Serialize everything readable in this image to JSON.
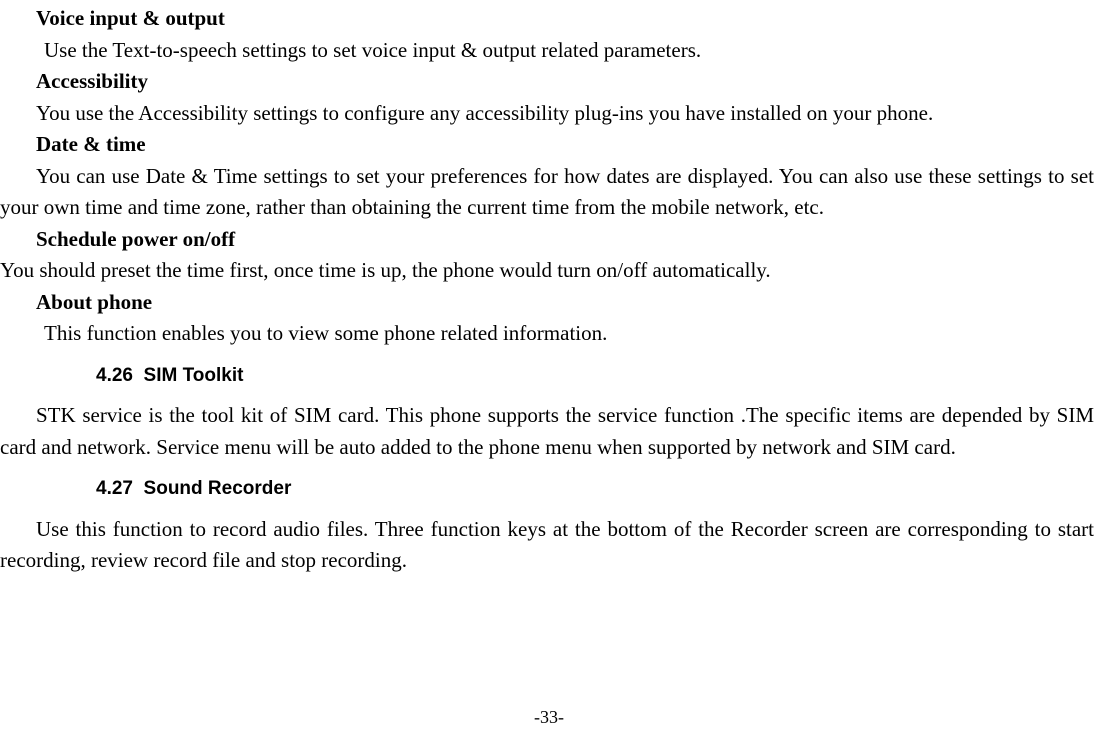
{
  "sections": {
    "voice": {
      "title": "Voice input & output",
      "body": "Use the Text-to-speech settings to set voice input & output related parameters."
    },
    "accessibility": {
      "title": "Accessibility",
      "body": "You use the Accessibility settings to configure any accessibility plug-ins you have installed on your phone."
    },
    "datetime": {
      "title": "Date & time",
      "body": "You can use Date & Time settings to set your preferences for how dates are displayed. You can also use these settings to set your own time and time zone, rather than obtaining the current time from the mobile network, etc."
    },
    "schedule": {
      "title": "Schedule power on/off",
      "body": "You should preset the time first, once time is up, the phone would turn on/off automatically."
    },
    "about": {
      "title": "About phone",
      "body": "This function enables you to view some phone related information."
    }
  },
  "headings": {
    "sim": {
      "number": "4.26",
      "text": "SIM Toolkit"
    },
    "sound": {
      "number": "4.27",
      "text": "Sound Recorder"
    }
  },
  "paragraphs": {
    "sim_body": "STK service is the tool kit of SIM card. This phone supports the service function .The specific items are depended by SIM card and network. Service menu will be auto added to the phone menu when supported by network and SIM card.",
    "sound_body": "Use this function to record audio files. Three function keys at the bottom of the Recorder screen are corresponding to start recording, review record file and stop recording."
  },
  "page_number": "-33-"
}
